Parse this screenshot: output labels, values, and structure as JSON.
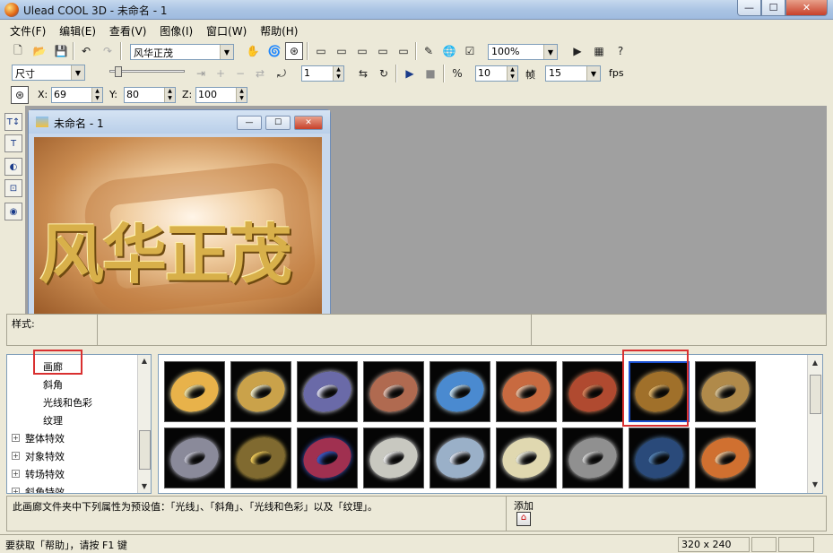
{
  "window": {
    "title": "Ulead COOL 3D - 未命名 - 1",
    "min": "—",
    "max": "☐",
    "close": "✕"
  },
  "menu": [
    "文件(F)",
    "编辑(E)",
    "查看(V)",
    "图像(I)",
    "窗口(W)",
    "帮助(H)"
  ],
  "toolbar1": {
    "text_combo": "风华正茂",
    "zoom_combo": "100%"
  },
  "toolbar2": {
    "mode_combo": "尺寸",
    "frame_value": "1",
    "frames_value": "10",
    "frames_label": "帧",
    "fps_value": "15",
    "fps_label": "fps"
  },
  "toolbar3": {
    "x_label": "X:",
    "x_value": "69",
    "y_label": "Y:",
    "y_value": "80",
    "z_label": "Z:",
    "z_value": "100"
  },
  "doc": {
    "title": "未命名 - 1",
    "canvas_text": "风华正茂"
  },
  "style_label": "样式:",
  "tree": {
    "items": [
      {
        "label": "画廊",
        "type": "child"
      },
      {
        "label": "斜角",
        "type": "child"
      },
      {
        "label": "光线和色彩",
        "type": "child"
      },
      {
        "label": "纹理",
        "type": "child"
      },
      {
        "label": "整体特效",
        "type": "folder"
      },
      {
        "label": "对象特效",
        "type": "folder"
      },
      {
        "label": "转场特效",
        "type": "folder"
      },
      {
        "label": "斜角特效",
        "type": "folder"
      }
    ]
  },
  "gallery": {
    "thumbs": [
      {
        "c1": "#e8b24a",
        "c2": "#fff0b0"
      },
      {
        "c1": "#caa24a",
        "c2": "#fff8d0"
      },
      {
        "c1": "#6a6aa8",
        "c2": "#e8e8ff"
      },
      {
        "c1": "#b06a50",
        "c2": "#f0c8b8"
      },
      {
        "c1": "#4a8ad0",
        "c2": "#c8e8ff"
      },
      {
        "c1": "#c86a40",
        "c2": "#f8c8a8"
      },
      {
        "c1": "#b04a30",
        "c2": "#e88a60"
      },
      {
        "c1": "#a0702a",
        "c2": "#f0c070"
      },
      {
        "c1": "#b08a4a",
        "c2": "#e8d0a0"
      },
      {
        "c1": "#8a8a9a",
        "c2": "#d0d0e0"
      },
      {
        "c1": "#806a30",
        "c2": "#ffd860"
      },
      {
        "c1": "#a03050",
        "c2": "#4060d0"
      },
      {
        "c1": "#c8c8c0",
        "c2": "#ffffff"
      },
      {
        "c1": "#9ab0c8",
        "c2": "#e8f0ff"
      },
      {
        "c1": "#e0d8b0",
        "c2": "#fffff0"
      },
      {
        "c1": "#909090",
        "c2": "#e0e0e0"
      },
      {
        "c1": "#2a4a7a",
        "c2": "#5a8ac0"
      },
      {
        "c1": "#d07030",
        "c2": "#ffd0a0"
      }
    ]
  },
  "description": "此画廊文件夹中下列属性为预设值：「光线」、「斜角」、「光线和色彩」以及「纹理」。",
  "add_label": "添加",
  "status": {
    "help": "要获取「帮助」，请按 F1 键",
    "size": "320 x 240"
  }
}
